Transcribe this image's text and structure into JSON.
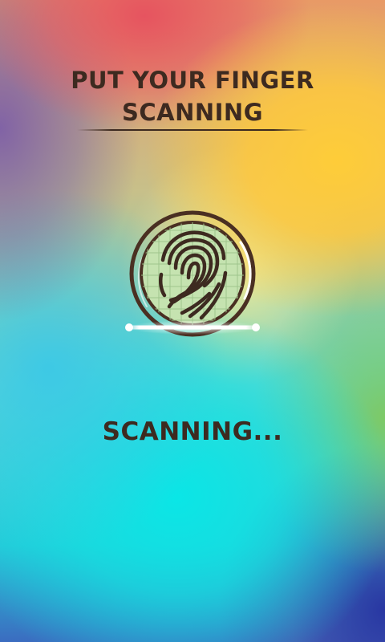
{
  "header": {
    "title_line1": "PUT YOUR FINGER",
    "title_line2": "SCANNING"
  },
  "scanner": {
    "icon": "fingerprint-icon",
    "scan_line_icon": "scan-line-icon"
  },
  "status": {
    "text": "SCANNING..."
  },
  "colors": {
    "text": "#3d2a20",
    "scanner_fill": "#c5e3b0",
    "scanner_ring": "#4a2f22",
    "scan_glow": "#ffffff"
  }
}
